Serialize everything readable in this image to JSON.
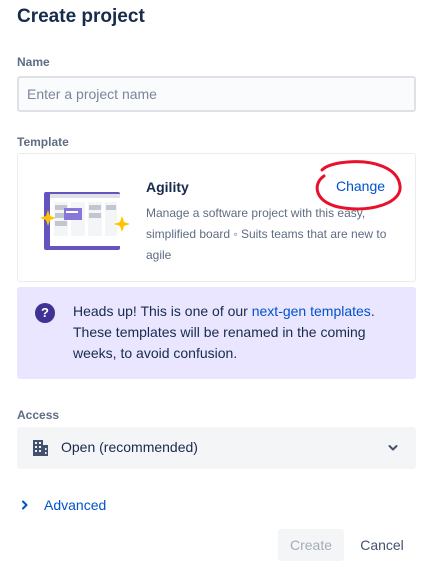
{
  "page": {
    "title": "Create project"
  },
  "name": {
    "label": "Name",
    "value": "",
    "placeholder": "Enter a project name"
  },
  "template": {
    "label": "Template",
    "name": "Agility",
    "change_label": "Change",
    "description": "Manage a software project with this easy, simplified board ◦ Suits teams that are new to agile",
    "annotation_color": "#e8102a"
  },
  "notice": {
    "icon": "question-icon",
    "icon_glyph": "?",
    "text_before": "Heads up! This is one of our ",
    "link_text": "next-gen templates",
    "text_after": ". These templates will be renamed in the coming weeks, to avoid confusion."
  },
  "access": {
    "label": "Access",
    "icon": "building-icon",
    "selected": "Open (recommended)"
  },
  "advanced": {
    "label": "Advanced",
    "expanded": false
  },
  "actions": {
    "create_label": "Create",
    "create_disabled": true,
    "cancel_label": "Cancel"
  },
  "colors": {
    "heading": "#172b4d",
    "label": "#5e6c84",
    "link": "#0052cc",
    "notice_bg": "#eae6ff",
    "notice_icon": "#403294",
    "select_bg": "#f4f5f7"
  }
}
